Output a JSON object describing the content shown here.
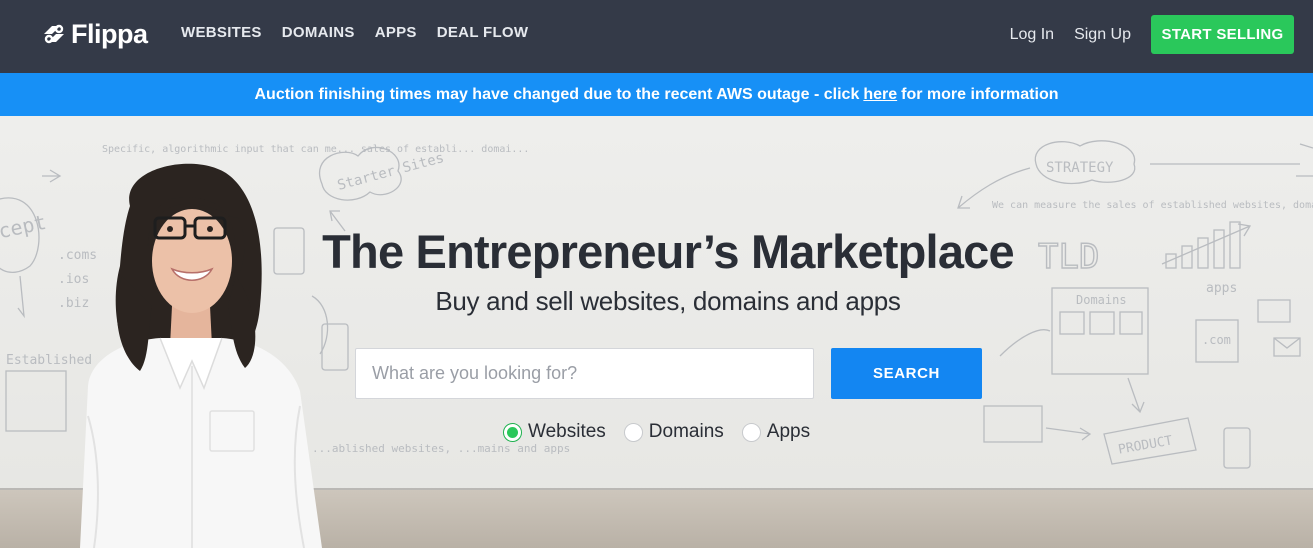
{
  "header": {
    "logo_text": "Flippa",
    "nav": [
      "WEBSITES",
      "DOMAINS",
      "APPS",
      "DEAL FLOW"
    ],
    "login_label": "Log In",
    "signup_label": "Sign Up",
    "start_selling_label": "START SELLING"
  },
  "banner": {
    "text_before": "Auction finishing times may have changed due to the recent AWS outage - click",
    "link": "here",
    "text_after": "for more information"
  },
  "hero": {
    "headline": "The Entrepreneur’s Marketplace",
    "subheadline": "Buy and sell websites, domains and apps",
    "search_placeholder": "What are you looking for?",
    "search_button": "SEARCH",
    "radio_options": [
      {
        "label": "Websites",
        "selected": true
      },
      {
        "label": "Domains",
        "selected": false
      },
      {
        "label": "Apps",
        "selected": false
      }
    ],
    "sketch_words": {
      "starter_sites": "Starter Sites",
      "strategy": "STRATEGY",
      "tld": "TLD",
      "domains": "Domains",
      "apps": "apps",
      "dotcom": ".com",
      "product": "PRODUCT",
      "established": "Established",
      "accept": "cept",
      "coms": ".coms",
      "ios": ".ios",
      "biz": ".biz",
      "note_left": "Specific, algorithmic input that can me... sales of establi... domai...",
      "note_right": "We can measure the sales of established websites, domains + apps, including...",
      "note_bottom": "...ablished websites, ...mains and apps"
    }
  },
  "colors": {
    "header_bg": "#343a48",
    "banner_bg": "#1790f6",
    "start_selling_bg": "#2ac85b",
    "search_bg": "#1386f2",
    "text_dark": "#2a2e36"
  },
  "icons": {
    "logo": "flippa-logo-icon",
    "radio_selected": "radio-checked-icon",
    "radio_unselected": "radio-unchecked-icon"
  }
}
